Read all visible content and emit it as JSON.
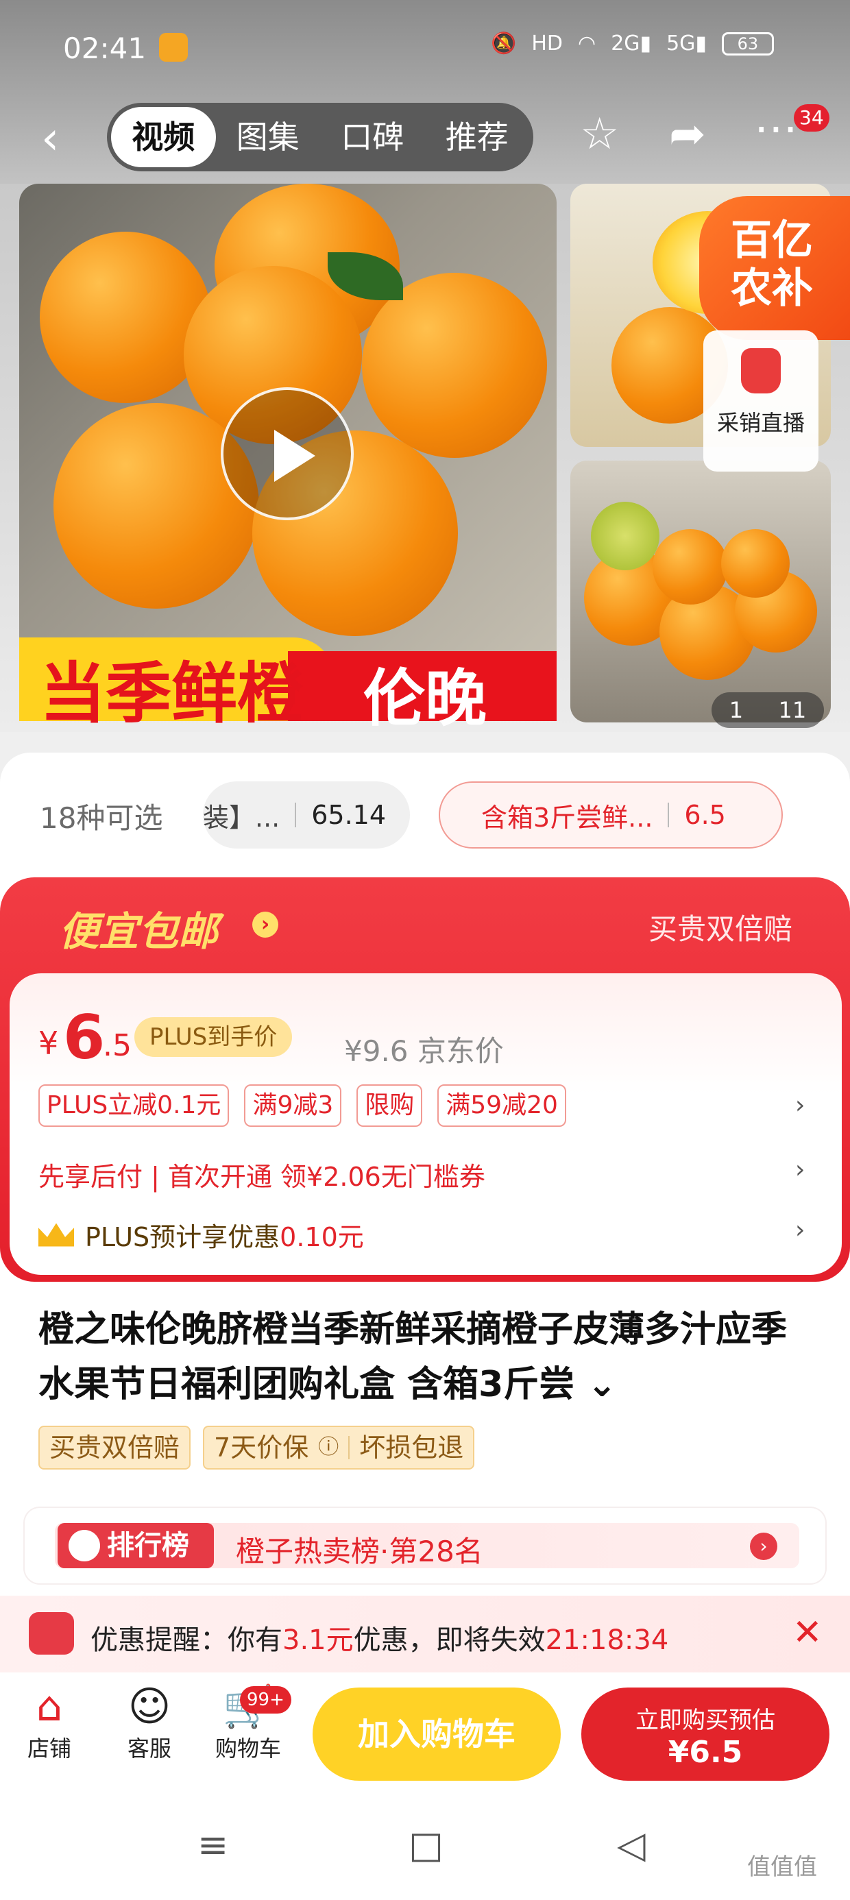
{
  "status_bar": {
    "time": "02:41",
    "icons": [
      "mute-icon",
      "hd-icon",
      "wifi-icon",
      "signal-2g-icon",
      "signal-5g-icon"
    ],
    "battery": "63"
  },
  "nav": {
    "tabs": [
      {
        "label": "视频",
        "active": true
      },
      {
        "label": "图集"
      },
      {
        "label": "口碑"
      },
      {
        "label": "推荐"
      }
    ],
    "badge": "34"
  },
  "gallery": {
    "banner_left": "当季鲜橙",
    "banner_right": "伦晚",
    "promo_badge": "百亿\n农补",
    "live_label": "采销直播",
    "page_current": "1",
    "page_total": "11"
  },
  "spec": {
    "count": "18种可选",
    "option1_name": "装】...",
    "option1_price": "65.14",
    "option2_name": "含箱3斤尝鲜...",
    "option2_price": "6.5"
  },
  "promo": {
    "title": "便宜包邮",
    "right": "买贵双倍赔",
    "price_symbol": "¥",
    "price_int": "6",
    "price_dec": ".5",
    "plus_tag": "PLUS到手价",
    "jd_price": "¥9.6 京东价",
    "coupons": [
      "PLUS立减0.1元",
      "满9减3",
      "限购",
      "满59减20"
    ],
    "first_use": "先享后付 | 首次开通 领¥2.06无门槛券",
    "plus_est_prefix": "PLUS预计享优惠",
    "plus_est_value": "0.10元"
  },
  "product": {
    "title": "橙之味伦晚脐橙当季新鲜采摘橙子皮薄多汁应季水果节日福利团购礼盒 含箱3斤尝",
    "chips": [
      "买贵双倍赔",
      "7天价保",
      "坏损包退"
    ]
  },
  "rank": {
    "badge": "排行榜",
    "text": "橙子热卖榜·第28名"
  },
  "reminder": {
    "prefix": "优惠提醒：你有",
    "amount": "3.1元",
    "middle": "优惠，即将失效",
    "countdown": "21:18:34"
  },
  "bottom": {
    "store": "店铺",
    "service": "客服",
    "cart": "购物车",
    "cart_badge": "99+",
    "add_cart": "加入购物车",
    "buy_line1": "立即购买预估",
    "buy_line2": "¥6.5"
  },
  "watermark": "值值值"
}
